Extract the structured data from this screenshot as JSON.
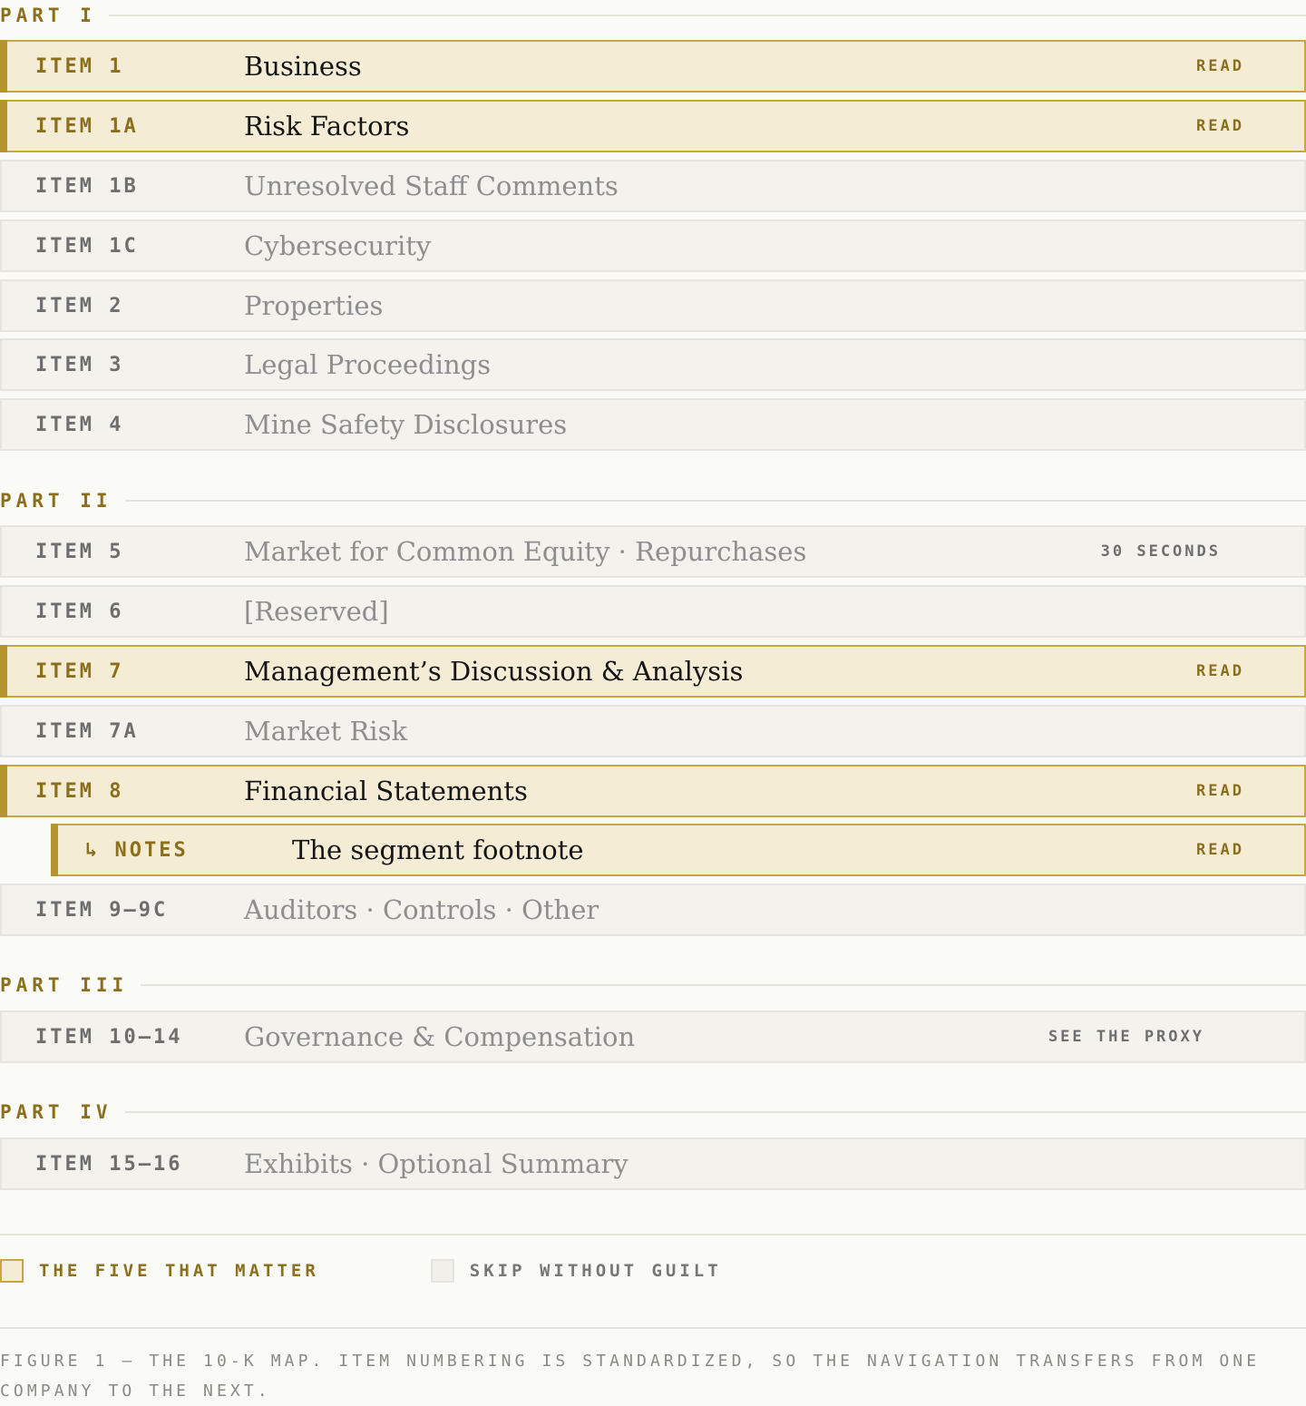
{
  "parts": [
    {
      "label": "PART I",
      "items": [
        {
          "code": "ITEM 1",
          "title": "Business",
          "tag": "READ",
          "highlight": true
        },
        {
          "code": "ITEM 1A",
          "title": "Risk Factors",
          "tag": "READ",
          "highlight": true
        },
        {
          "code": "ITEM 1B",
          "title": "Unresolved Staff Comments",
          "tag": "",
          "highlight": false
        },
        {
          "code": "ITEM 1C",
          "title": "Cybersecurity",
          "tag": "",
          "highlight": false
        },
        {
          "code": "ITEM 2",
          "title": "Properties",
          "tag": "",
          "highlight": false
        },
        {
          "code": "ITEM 3",
          "title": "Legal Proceedings",
          "tag": "",
          "highlight": false
        },
        {
          "code": "ITEM 4",
          "title": "Mine Safety Disclosures",
          "tag": "",
          "highlight": false
        }
      ]
    },
    {
      "label": "PART II",
      "items": [
        {
          "code": "ITEM 5",
          "title": "Market for Common Equity · Repurchases",
          "tag": "30 SECONDS",
          "highlight": false
        },
        {
          "code": "ITEM 6",
          "title": "[Reserved]",
          "tag": "",
          "highlight": false
        },
        {
          "code": "ITEM 7",
          "title": "Management’s Discussion & Analysis",
          "tag": "READ",
          "highlight": true
        },
        {
          "code": "ITEM 7A",
          "title": "Market Risk",
          "tag": "",
          "highlight": false
        },
        {
          "code": "ITEM 8",
          "title": "Financial Statements",
          "tag": "READ",
          "highlight": true
        },
        {
          "code": "↳ NOTES",
          "title": "The segment footnote",
          "tag": "READ",
          "highlight": true,
          "sub": true
        },
        {
          "code": "ITEM 9–9C",
          "title": "Auditors · Controls · Other",
          "tag": "",
          "highlight": false
        }
      ]
    },
    {
      "label": "PART III",
      "items": [
        {
          "code": "ITEM 10–14",
          "title": "Governance & Compensation",
          "tag": "SEE THE PROXY",
          "highlight": false
        }
      ]
    },
    {
      "label": "PART IV",
      "items": [
        {
          "code": "ITEM 15–16",
          "title": "Exhibits · Optional Summary",
          "tag": "",
          "highlight": false
        }
      ]
    }
  ],
  "legend": {
    "highlight_label": "THE FIVE THAT MATTER",
    "skip_label": "SKIP WITHOUT GUILT"
  },
  "caption": "FIGURE 1 — THE 10-K MAP. ITEM NUMBERING IS STANDARDIZED, SO THE NAVIGATION TRANSFERS FROM ONE COMPANY TO THE NEXT.",
  "colors": {
    "accent": "#b5942d",
    "accent_text": "#8c6f1c",
    "highlight_bg": "#f5ecd6",
    "row_bg": "#f3f2ed",
    "page_bg": "#fafaf6"
  }
}
